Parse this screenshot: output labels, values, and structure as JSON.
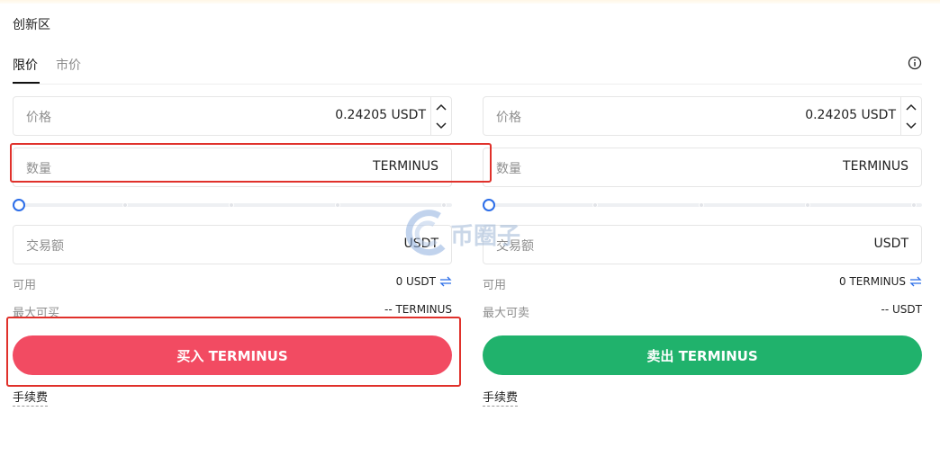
{
  "section_title": "创新区",
  "tabs": [
    {
      "label": "限价",
      "active": true
    },
    {
      "label": "市价",
      "active": false
    }
  ],
  "icons": {
    "info": "info-circle-icon",
    "swap": "swap-arrows-icon",
    "up": "chevron-up-icon",
    "down": "chevron-down-icon"
  },
  "colors": {
    "buy": "#f24b62",
    "sell": "#20b26c",
    "slider_handle": "#2b6de8",
    "highlight": "#e0312b"
  },
  "buy": {
    "price_label": "价格",
    "price_value": "0.24205 USDT",
    "amount_label": "数量",
    "amount_unit": "TERMINUS",
    "slider_value": 0,
    "total_label": "交易额",
    "total_unit": "USDT",
    "available_label": "可用",
    "available_value": "0 USDT",
    "max_label": "最大可买",
    "max_value": "-- TERMINUS",
    "button_label": "买入 TERMINUS",
    "fee_label": "手续费"
  },
  "sell": {
    "price_label": "价格",
    "price_value": "0.24205 USDT",
    "amount_label": "数量",
    "amount_unit": "TERMINUS",
    "slider_value": 0,
    "total_label": "交易额",
    "total_unit": "USDT",
    "available_label": "可用",
    "available_value": "0 TERMINUS",
    "max_label": "最大可卖",
    "max_value": "-- USDT",
    "button_label": "卖出 TERMINUS",
    "fee_label": "手续费"
  },
  "watermark": "币圈子"
}
